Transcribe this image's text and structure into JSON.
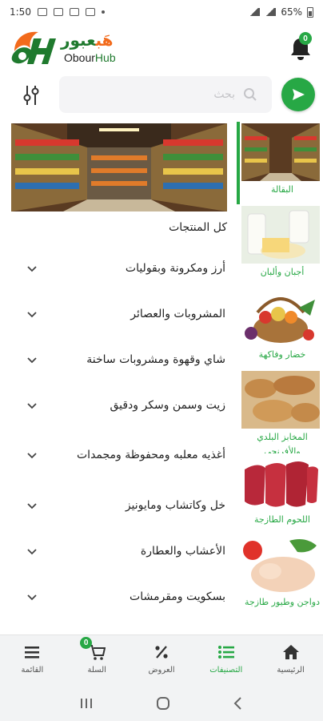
{
  "status_bar": {
    "time": "1:50",
    "battery": "65%"
  },
  "header": {
    "logo_ar_part1": "عبور",
    "logo_ar_part2": "هَب",
    "logo_en_part1": "Obour",
    "logo_en_part2": "Hub",
    "notification_count": "0"
  },
  "search": {
    "placeholder": "بحث"
  },
  "main": {
    "all_products_label": "كل المنتجات",
    "categories": [
      {
        "label": "أرز ومكرونة وبقوليات"
      },
      {
        "label": "المشروبات والعصائر"
      },
      {
        "label": "شاي وقهوة ومشروبات ساخنة"
      },
      {
        "label": "زيت وسمن وسكر ودقيق"
      },
      {
        "label": "أغذيه معلبه ومحفوظة ومجمدات"
      },
      {
        "label": "خل وكاتشاب ومايونيز"
      },
      {
        "label": "الأعشاب والعطارة"
      },
      {
        "label": "بسكويت ومقرمشات"
      }
    ]
  },
  "sidebar": {
    "items": [
      {
        "label": "البقالة",
        "image": "grocery-aisle"
      },
      {
        "label": "أجبان وألبان",
        "image": "dairy"
      },
      {
        "label": "خضار وفاكهة",
        "image": "vegetables-fruit-basket"
      },
      {
        "label": "المخابز البلدي والأفرنجي",
        "image": "bread"
      },
      {
        "label": "اللحوم الطازجة",
        "image": "red-meat"
      },
      {
        "label": "دواجن وطيور طازجة",
        "image": "poultry"
      }
    ]
  },
  "bottom_nav": {
    "items": [
      {
        "label": "القائمة",
        "icon": "menu-icon"
      },
      {
        "label": "السلة",
        "icon": "cart-icon",
        "badge": "0"
      },
      {
        "label": "العروض",
        "icon": "percent-icon"
      },
      {
        "label": "التصنيفات",
        "icon": "categories-icon"
      },
      {
        "label": "الرئيسية",
        "icon": "home-icon"
      }
    ]
  },
  "colors": {
    "accent": "#27a845",
    "brand_orange": "#f26a1b",
    "brand_green": "#1f7a2e"
  }
}
